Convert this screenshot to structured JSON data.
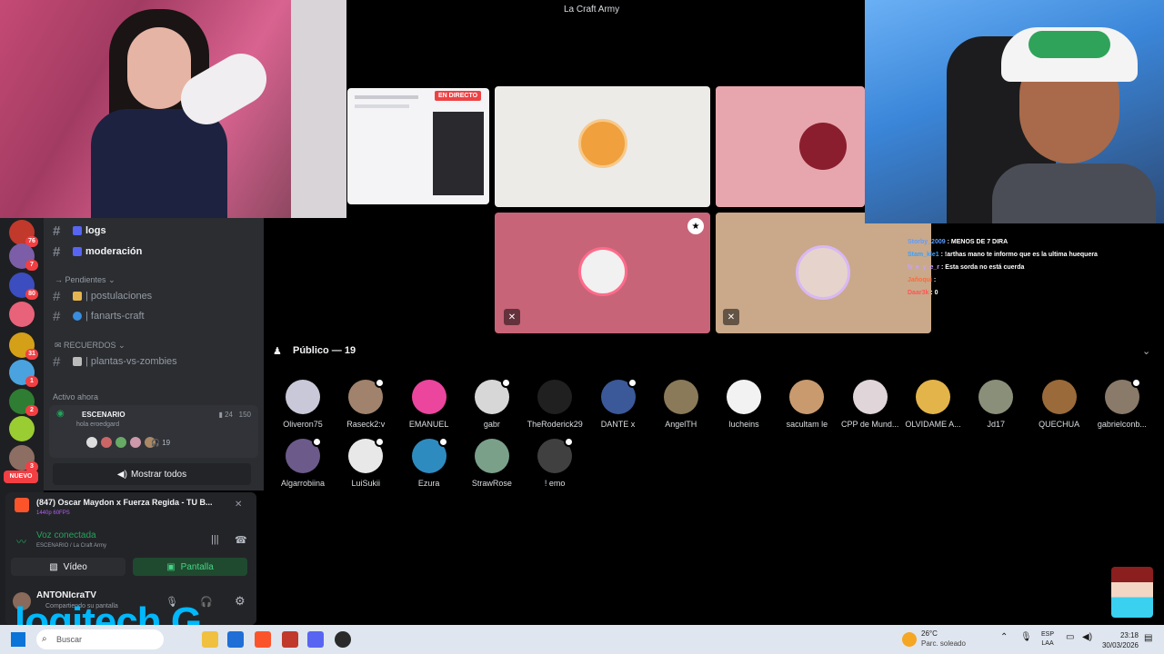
{
  "stage": {
    "title": "La Craft Army",
    "live_badge": "EN DIRECTO"
  },
  "sidebar": {
    "server_badges": [
      "76",
      "7",
      "80",
      "",
      "31",
      "1",
      "2",
      "",
      "3"
    ],
    "nuevo_label": "NUEVO",
    "channels": [
      {
        "label": "logs",
        "unread": true
      },
      {
        "label": "moderación",
        "unread": true
      }
    ],
    "category_pendientes": "Pendientes",
    "channels_pendientes": [
      {
        "label": "| postulaciones"
      },
      {
        "label": "| fanarts-craft"
      }
    ],
    "category_recuerdos": "RECUERDOS",
    "channels_recuerdos": [
      {
        "label": "| plantas-vs-zombies"
      }
    ],
    "active_now": "Activo ahora",
    "stage_card": {
      "title": "ESCENARIO",
      "subtitle": "hola eroedgard",
      "viewers": "24",
      "total": "150",
      "listeners": "19"
    },
    "show_all": "Mostrar todos"
  },
  "panel": {
    "now_playing": "(847) Oscar Maydon x Fuerza Regida - TU B...",
    "now_playing_sub": "1440p 60FPS",
    "voice_title": "Voz conectada",
    "voice_sub": "ESCENARIO / La Craft Army",
    "video_label": "Vídeo",
    "screen_label": "Pantalla",
    "username": "ANTONIcraTV",
    "user_status": "Compartiendo su pantalla"
  },
  "chat": [
    {
      "user": "Storby_2009",
      "text": ": MENOS DE 7 DIRA"
    },
    {
      "user": "Stam_kle1",
      "text": ": !arthas mano te informo que es la ultima huequera"
    },
    {
      "user": "N_e_y_e_r",
      "text": ": Esta sorda no está cuerda"
    },
    {
      "user": "Jañoqui",
      "text": ":"
    },
    {
      "user": "Daar3k",
      "text": ": 0"
    }
  ],
  "audience": {
    "heading": "Público — 19",
    "people": [
      {
        "name": "Oliveron75",
        "color": "#c8c8d8"
      },
      {
        "name": "Raseck2:v",
        "color": "#a0826d"
      },
      {
        "name": "EMANUEL",
        "color": "#eb459e"
      },
      {
        "name": "gabr",
        "color": "#d7d7d7"
      },
      {
        "name": "TheRoderick29",
        "color": "#202020"
      },
      {
        "name": "DANTE x",
        "color": "#3b5998"
      },
      {
        "name": "AngelTH",
        "color": "#8a7a5a"
      },
      {
        "name": "lucheins",
        "color": "#f2f2f2"
      },
      {
        "name": "sacultam le",
        "color": "#c99a6e"
      },
      {
        "name": "CPP de Mund...",
        "color": "#e0d6da"
      },
      {
        "name": "OLVIDAME A...",
        "color": "#e3b44a"
      },
      {
        "name": "Jd17",
        "color": "#8a8f7a"
      },
      {
        "name": "QUECHUA",
        "color": "#9a6a3a"
      },
      {
        "name": "gabrielconb...",
        "color": "#8a7a6a"
      },
      {
        "name": "Algarrobiina",
        "color": "#6b5a8a"
      },
      {
        "name": "LuiSukii",
        "color": "#e8e8e8"
      },
      {
        "name": "Ezura",
        "color": "#2e8bc0"
      },
      {
        "name": "StrawRose",
        "color": "#7aa08a"
      },
      {
        "name": "! emo",
        "color": "#404040"
      }
    ]
  },
  "taskbar": {
    "search_placeholder": "Buscar",
    "temperature": "26°C",
    "weather": "Parc. soleado",
    "lang_top": "ESP",
    "lang_bottom": "LAA",
    "time": "23:18",
    "date": "30/03/2026"
  },
  "overlay": {
    "logo_text": "logitech G"
  }
}
